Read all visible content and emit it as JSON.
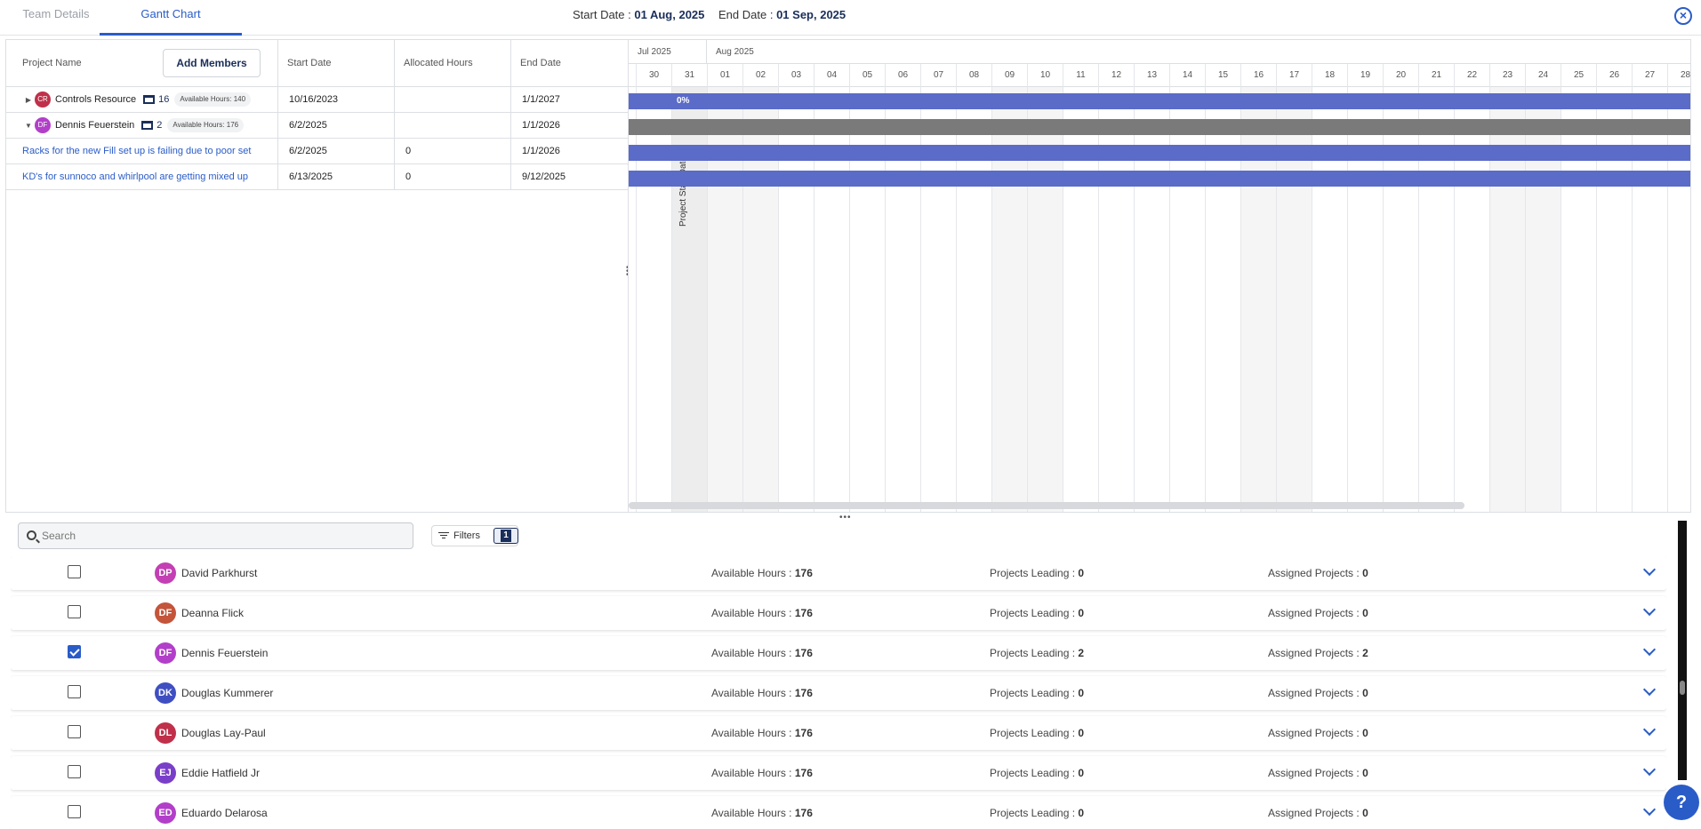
{
  "tabs": [
    {
      "label": "Team Details",
      "active": false
    },
    {
      "label": "Gantt Chart",
      "active": true
    }
  ],
  "header": {
    "start_label": "Start Date :",
    "start_value": "01 Aug, 2025",
    "end_label": "End Date :",
    "end_value": "01 Sep, 2025"
  },
  "grid": {
    "columns": [
      "Project Name",
      "Start Date",
      "Allocated Hours",
      "End Date"
    ],
    "add_members_label": "Add Members",
    "rows": [
      {
        "type": "resource",
        "expanded": false,
        "initials": "CR",
        "avatar_color": "#c0304a",
        "name": "Controls Resource",
        "projects": "16",
        "avail_label": "Available Hours:",
        "avail_value": "140",
        "start": "10/16/2023",
        "allocated": "",
        "end": "1/1/2027"
      },
      {
        "type": "resource",
        "expanded": true,
        "initials": "DF",
        "avatar_color": "#b23fc9",
        "name": "Dennis Feuerstein",
        "projects": "2",
        "avail_label": "Available Hours:",
        "avail_value": "176",
        "start": "6/2/2025",
        "allocated": "",
        "end": "1/1/2026"
      },
      {
        "type": "task",
        "name": "Racks for the new Fill set up is failing due to poor set",
        "start": "6/2/2025",
        "allocated": "0",
        "end": "1/1/2026"
      },
      {
        "type": "task",
        "name": "KD's for sunnoco and whirlpool are getting mixed up",
        "start": "6/13/2025",
        "allocated": "0",
        "end": "9/12/2025"
      }
    ]
  },
  "gantt": {
    "months": [
      "Jul 2025",
      "Aug 2025"
    ],
    "days": [
      "2",
      "30",
      "31",
      "01",
      "02",
      "03",
      "04",
      "05",
      "06",
      "07",
      "08",
      "09",
      "10",
      "11",
      "12",
      "13",
      "14",
      "15",
      "16",
      "17",
      "18",
      "19",
      "20",
      "21",
      "22",
      "23",
      "24",
      "25",
      "26",
      "27",
      "28"
    ],
    "start_marker_label": "Project Start Date",
    "bars": [
      {
        "color": "#5b6bc8",
        "label": "0%"
      },
      {
        "color": "#7a7a7a",
        "label": ""
      },
      {
        "color": "#5b6bc8",
        "label": ""
      },
      {
        "color": "#5b6bc8",
        "label": ""
      }
    ],
    "colors": {
      "task_bar": "#5b6bc8",
      "resource_bar": "#7a7a7a"
    }
  },
  "search": {
    "placeholder": "Search"
  },
  "filters": {
    "label": "Filters",
    "count": "1"
  },
  "members": {
    "avail_label": "Available Hours :",
    "leading_label": "Projects Leading :",
    "assigned_label": "Assigned Projects :",
    "items": [
      {
        "initials": "DP",
        "color": "#c33fb3",
        "name": "David Parkhurst",
        "checked": false,
        "avail": "176",
        "leading": "0",
        "assigned": "0"
      },
      {
        "initials": "DF",
        "color": "#c4543a",
        "name": "Deanna Flick",
        "checked": false,
        "avail": "176",
        "leading": "0",
        "assigned": "0"
      },
      {
        "initials": "DF",
        "color": "#b23fc9",
        "name": "Dennis Feuerstein",
        "checked": true,
        "avail": "176",
        "leading": "2",
        "assigned": "2"
      },
      {
        "initials": "DK",
        "color": "#3f4fc2",
        "name": "Douglas Kummerer",
        "checked": false,
        "avail": "176",
        "leading": "0",
        "assigned": "0"
      },
      {
        "initials": "DL",
        "color": "#c0304a",
        "name": "Douglas Lay-Paul",
        "checked": false,
        "avail": "176",
        "leading": "0",
        "assigned": "0"
      },
      {
        "initials": "EJ",
        "color": "#7a3fc9",
        "name": "Eddie Hatfield Jr",
        "checked": false,
        "avail": "176",
        "leading": "0",
        "assigned": "0"
      },
      {
        "initials": "ED",
        "color": "#b23fc9",
        "name": "Eduardo Delarosa",
        "checked": false,
        "avail": "176",
        "leading": "0",
        "assigned": "0"
      }
    ]
  },
  "help_label": "?"
}
